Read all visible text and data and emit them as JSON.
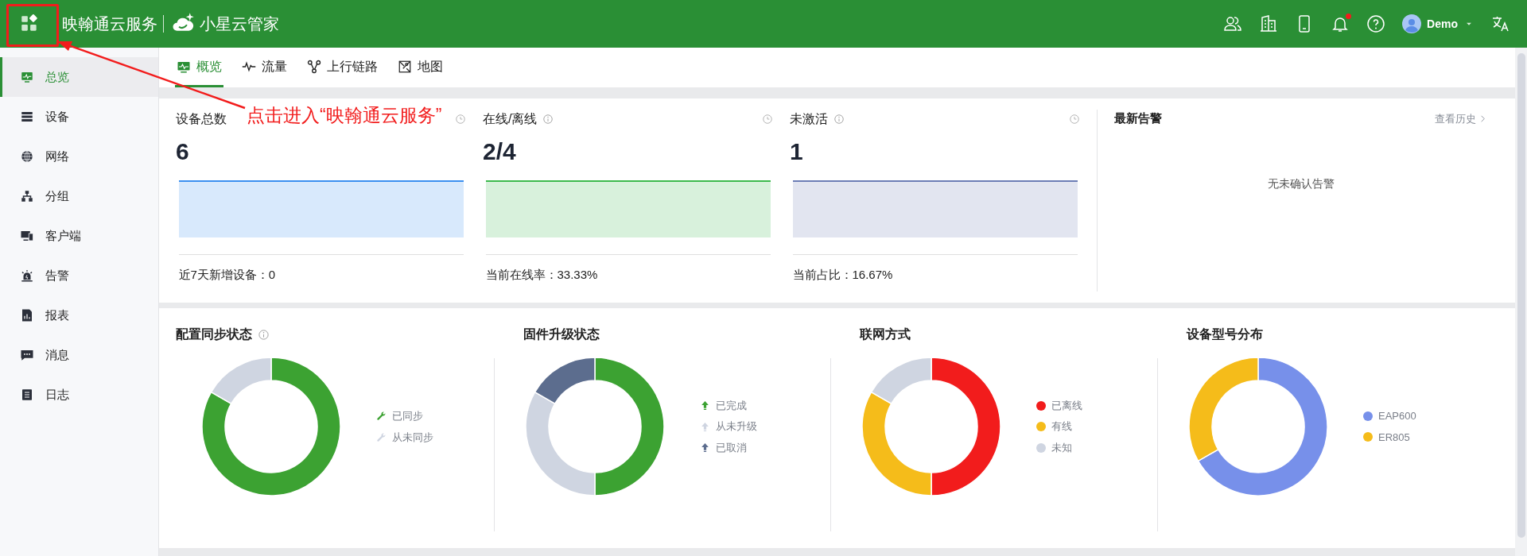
{
  "header": {
    "app_name": "映翰通云服务",
    "brand": "小星云管家",
    "user": "Demo",
    "notification_dot": true
  },
  "annotation": {
    "text": "点击进入“映翰通云服务”"
  },
  "sidebar": {
    "items": [
      {
        "label": "总览",
        "selected": true
      },
      {
        "label": "设备",
        "selected": false
      },
      {
        "label": "网络",
        "selected": false
      },
      {
        "label": "分组",
        "selected": false
      },
      {
        "label": "客户端",
        "selected": false
      },
      {
        "label": "告警",
        "selected": false
      },
      {
        "label": "报表",
        "selected": false
      },
      {
        "label": "消息",
        "selected": false
      },
      {
        "label": "日志",
        "selected": false
      }
    ]
  },
  "tabs": [
    {
      "label": "概览",
      "selected": true
    },
    {
      "label": "流量",
      "selected": false
    },
    {
      "label": "上行链路",
      "selected": false
    },
    {
      "label": "地图",
      "selected": false
    }
  ],
  "stats": [
    {
      "title": "设备总数",
      "info": false,
      "value": "6",
      "color": "#3b8ff0",
      "footer": "近7天新增设备：0"
    },
    {
      "title": "在线/离线",
      "info": true,
      "value": "2/4",
      "color": "#3dba4e",
      "footer": "当前在线率：33.33%"
    },
    {
      "title": "未激活",
      "info": true,
      "value": "1",
      "color": "#6c7eb5",
      "footer": "当前占比：16.67%"
    }
  ],
  "alerts": {
    "title": "最新告警",
    "link": "查看历史",
    "empty": "无未确认告警"
  },
  "charts": [
    {
      "title": "配置同步状态",
      "info": true,
      "kind": "wrench",
      "chart_data": {
        "type": "donut",
        "categories": [
          "已同步",
          "从未同步"
        ],
        "series": [
          {
            "colors": [
              "#3ca232",
              "#cfd5e1"
            ],
            "values": [
              83.3,
              16.7
            ]
          }
        ]
      }
    },
    {
      "title": "固件升级状态",
      "info": false,
      "kind": "arrow",
      "chart_data": {
        "type": "donut",
        "categories": [
          "已完成",
          "从未升级",
          "已取消"
        ],
        "series": [
          {
            "colors": [
              "#3ca232",
              "#cfd5e1",
              "#5c6d8e"
            ],
            "values": [
              50,
              33.3,
              16.7
            ]
          }
        ]
      }
    },
    {
      "title": "联网方式",
      "info": false,
      "kind": "dot",
      "chart_data": {
        "type": "donut",
        "categories": [
          "已离线",
          "有线",
          "未知"
        ],
        "series": [
          {
            "colors": [
              "#f21c1c",
              "#f5bc1a",
              "#cfd5e1"
            ],
            "values": [
              50,
              33.3,
              16.7
            ]
          }
        ]
      }
    },
    {
      "title": "设备型号分布",
      "info": false,
      "kind": "dot",
      "chart_data": {
        "type": "donut",
        "categories": [
          "EAP600",
          "ER805"
        ],
        "series": [
          {
            "colors": [
              "#7790ea",
              "#f5bc1a"
            ],
            "values": [
              66.7,
              33.3
            ]
          }
        ]
      }
    }
  ]
}
